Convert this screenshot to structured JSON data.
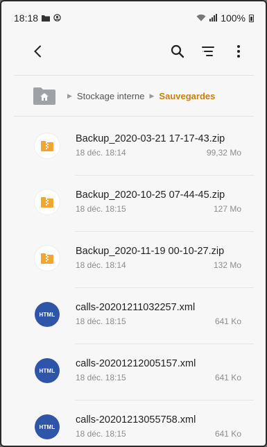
{
  "status_bar": {
    "time": "18:18",
    "battery": "100%"
  },
  "breadcrumb": {
    "items": [
      "Stockage interne"
    ],
    "current": "Sauvegardes"
  },
  "files": [
    {
      "name": "Backup_2020-03-21 17-17-43.zip",
      "date": "18 déc. 18:14",
      "size": "99,32 Mo",
      "type": "zip"
    },
    {
      "name": "Backup_2020-10-25 07-44-45.zip",
      "date": "18 déc. 18:15",
      "size": "127 Mo",
      "type": "zip"
    },
    {
      "name": "Backup_2020-11-19 00-10-27.zip",
      "date": "18 déc. 18:14",
      "size": "132 Mo",
      "type": "zip"
    },
    {
      "name": "calls-20201211032257.xml",
      "date": "18 déc. 18:15",
      "size": "641 Ko",
      "type": "html",
      "badge": "HTML"
    },
    {
      "name": "calls-20201212005157.xml",
      "date": "18 déc. 18:15",
      "size": "641 Ko",
      "type": "html",
      "badge": "HTML"
    },
    {
      "name": "calls-20201213055758.xml",
      "date": "18 déc. 18:15",
      "size": "641 Ko",
      "type": "html",
      "badge": "HTML"
    }
  ],
  "colors": {
    "accent": "#c8800a",
    "zip_icon": "#f2a531",
    "html_badge": "#2f55a8"
  }
}
